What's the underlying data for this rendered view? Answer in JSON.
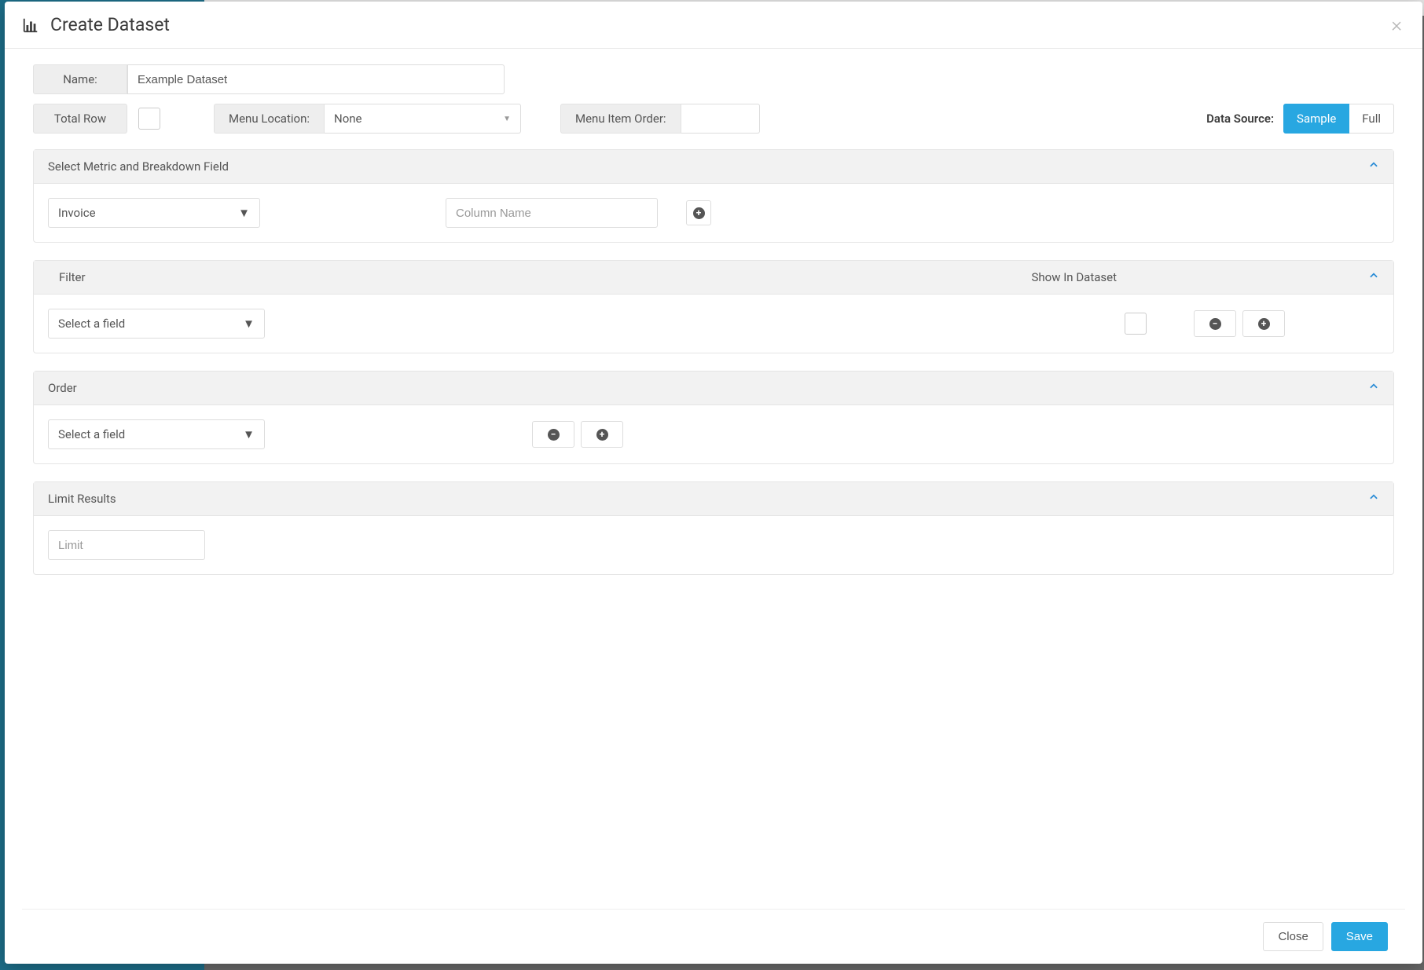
{
  "modal": {
    "title": "Create Dataset",
    "name_label": "Name:",
    "name_value": "Example Dataset",
    "total_row_label": "Total Row",
    "total_row_checked": false,
    "menu_location_label": "Menu Location:",
    "menu_location_value": "None",
    "menu_item_order_label": "Menu Item Order:",
    "menu_item_order_value": "",
    "data_source_label": "Data Source:",
    "data_source_options": {
      "sample": "Sample",
      "full": "Full"
    },
    "data_source_selected": "sample"
  },
  "panels": {
    "metric": {
      "title": "Select Metric and Breakdown Field",
      "field_value": "Invoice",
      "column_placeholder": "Column Name"
    },
    "filter": {
      "title": "Filter",
      "show_label": "Show In Dataset",
      "field_placeholder": "Select a field"
    },
    "order": {
      "title": "Order",
      "field_placeholder": "Select a field"
    },
    "limit": {
      "title": "Limit Results",
      "placeholder": "Limit"
    }
  },
  "footer": {
    "close": "Close",
    "save": "Save"
  }
}
